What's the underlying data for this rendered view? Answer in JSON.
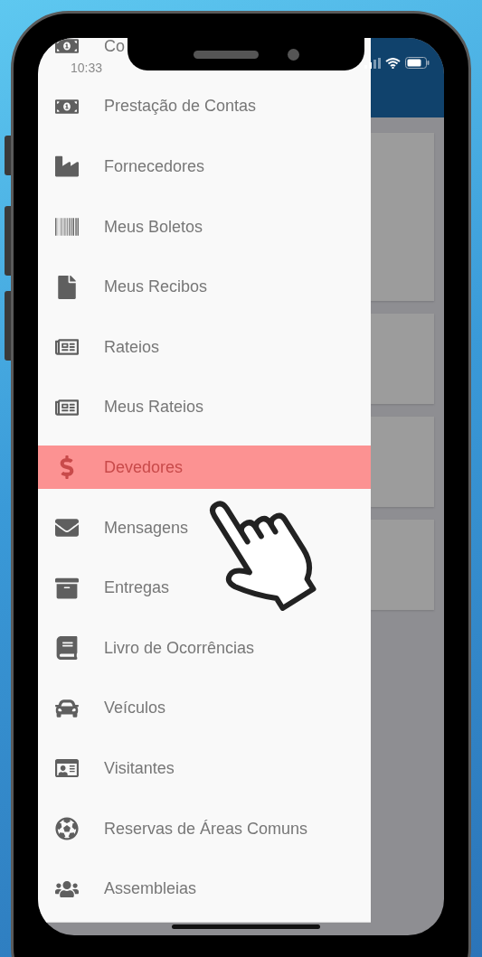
{
  "status_bar": {
    "time": "10:33"
  },
  "drawer": {
    "items": [
      {
        "label": "Co",
        "selected": false
      },
      {
        "label": "Prestação de Contas",
        "selected": false
      },
      {
        "label": "Fornecedores",
        "selected": false
      },
      {
        "label": "Meus Boletos",
        "selected": false
      },
      {
        "label": "Meus Recibos",
        "selected": false
      },
      {
        "label": "Rateios",
        "selected": false
      },
      {
        "label": "Meus Rateios",
        "selected": false
      },
      {
        "label": "Devedores",
        "selected": true
      },
      {
        "label": "Mensagens",
        "selected": false
      },
      {
        "label": "Entregas",
        "selected": false
      },
      {
        "label": "Livro de Ocorrências",
        "selected": false
      },
      {
        "label": "Veículos",
        "selected": false
      },
      {
        "label": "Visitantes",
        "selected": false
      },
      {
        "label": "Reservas de Áreas Comuns",
        "selected": false
      },
      {
        "label": "Assembleias",
        "selected": false
      }
    ]
  }
}
